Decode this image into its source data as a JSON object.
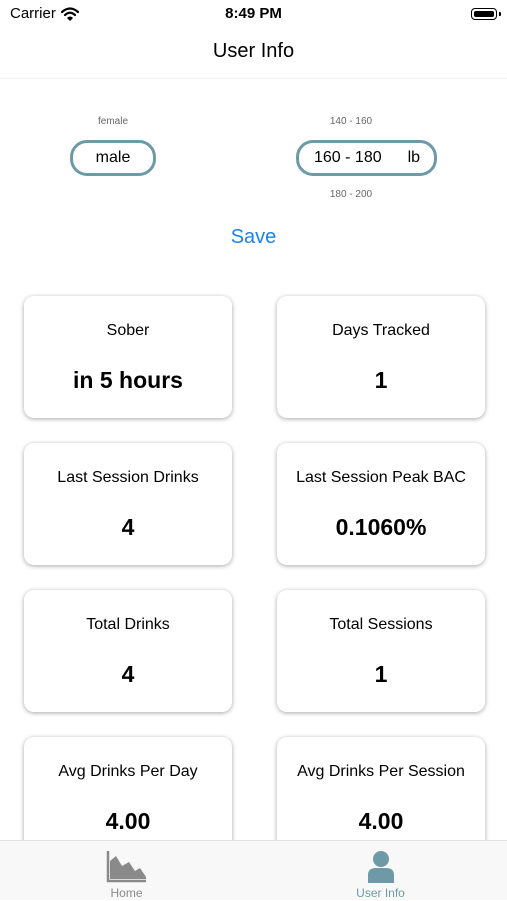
{
  "status_bar": {
    "carrier": "Carrier",
    "time": "8:49 PM"
  },
  "header": {
    "title": "User Info"
  },
  "gender_picker": {
    "above": "female",
    "selected": "male"
  },
  "weight_picker": {
    "above": "140 - 160",
    "selected": "160 - 180",
    "unit": "lb",
    "below": "180 - 200"
  },
  "save_label": "Save",
  "stats": [
    {
      "label": "Sober",
      "value": "in 5 hours"
    },
    {
      "label": "Days Tracked",
      "value": "1"
    },
    {
      "label": "Last Session Drinks",
      "value": "4"
    },
    {
      "label": "Last Session Peak BAC",
      "value": "0.1060%"
    },
    {
      "label": "Total Drinks",
      "value": "4"
    },
    {
      "label": "Total Sessions",
      "value": "1"
    },
    {
      "label": "Avg Drinks Per Day",
      "value": "4.00"
    },
    {
      "label": "Avg Drinks Per Session",
      "value": "4.00"
    }
  ],
  "tab_bar": {
    "tabs": [
      {
        "label": "Home",
        "icon": "area-chart-icon"
      },
      {
        "label": "User Info",
        "icon": "user-icon"
      }
    ],
    "active": "User Info"
  },
  "colors": {
    "accent": "#6e9aa8",
    "link": "#1a82f0",
    "inactive": "#8a8a8a"
  }
}
